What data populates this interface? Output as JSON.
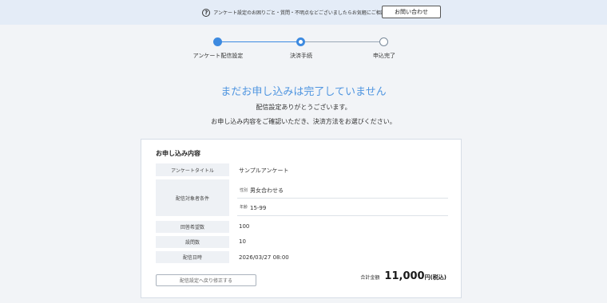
{
  "topbar": {
    "help_icon": "?",
    "text": "アンケート設定のお困りごと・質問・不明点などございましたらお気軽にご相談ください",
    "contact_button": "お問い合わせ"
  },
  "stepper": {
    "steps": [
      {
        "label": "アンケート配信設定",
        "state": "done"
      },
      {
        "label": "決済手続",
        "state": "current"
      },
      {
        "label": "申込完了",
        "state": "todo"
      }
    ]
  },
  "headline": "まだお申し込みは完了していません",
  "messages": [
    "配信設定ありがとうございます。",
    "お申し込み内容をご確認いただき、決済方法をお選びください。"
  ],
  "summary": {
    "title": "お申し込み内容",
    "survey_title_label": "アンケートタイトル",
    "survey_title_value": "サンプルアンケート",
    "target_label": "配信対象者条件",
    "target_gender_label": "性別",
    "target_gender_value": "男女合わせる",
    "target_age_label": "年齢",
    "target_age_value": "15-99",
    "responses_label": "回答希望数",
    "responses_value": "100",
    "questions_label": "設問数",
    "questions_value": "10",
    "datetime_label": "配信日時",
    "datetime_value": "2026/03/27 08:00",
    "back_button": "配信設定へ戻り修正する",
    "total_label": "合計金額",
    "total_amount": "11,000",
    "total_suffix": "円(税込)"
  },
  "colors": {
    "accent": "#3d8ae0",
    "headline": "#4f95e0",
    "topbar_bg": "#e4ecf7",
    "page_bg": "#f2f4f7"
  }
}
